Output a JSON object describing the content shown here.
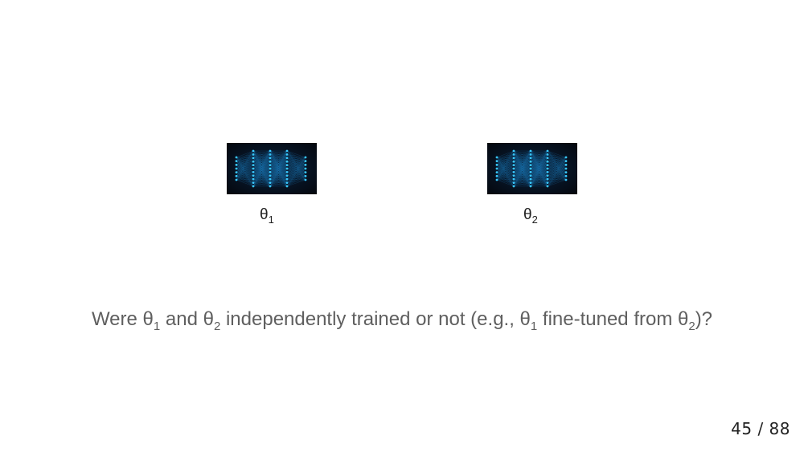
{
  "slide": {
    "images": [
      {
        "name": "neural-network-diagram-theta-1",
        "symbol": "θ",
        "subscript": "1"
      },
      {
        "name": "neural-network-diagram-theta-2",
        "symbol": "θ",
        "subscript": "2"
      }
    ],
    "question": {
      "part1": "Were θ",
      "sub1": "1",
      "part2": " and θ",
      "sub2": "2",
      "part3": " independently trained or not (e.g., θ",
      "sub3": "1",
      "part4": " fine-tuned from θ",
      "sub4": "2",
      "part5": ")?"
    },
    "page_number": "45 / 88"
  },
  "colors": {
    "background": "#ffffff",
    "question_text": "#5f5f5f",
    "label_text": "#222222",
    "network_node": "#38c8ff",
    "network_edge": "#1e8fd6"
  }
}
